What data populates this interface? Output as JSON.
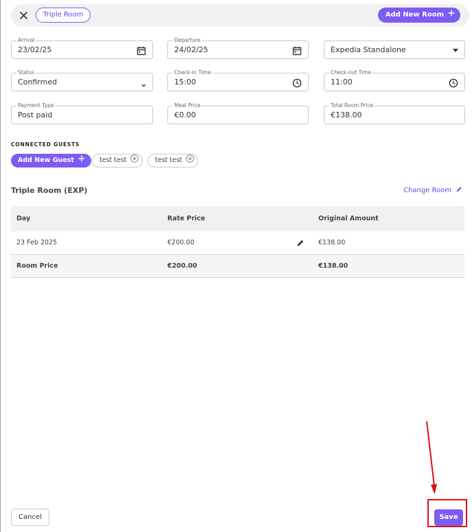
{
  "header": {
    "room_chip": "Triple Room",
    "add_room_label": "Add New Room"
  },
  "fields": {
    "arrival": {
      "label": "Arrival",
      "value": "23/02/25"
    },
    "departure": {
      "label": "Departure",
      "value": "24/02/25"
    },
    "channel": {
      "value": "Expedia Standalone"
    },
    "status": {
      "label": "Status",
      "value": "Confirmed"
    },
    "checkin": {
      "label": "Check-in Time",
      "value": "15:00"
    },
    "checkout": {
      "label": "Check-out Time",
      "value": "11:00"
    },
    "payment": {
      "label": "Payment Type",
      "value": "Post paid"
    },
    "meal_price": {
      "label": "Meal Price",
      "value": "€0.00"
    },
    "total_room_price": {
      "label": "Total Room Price",
      "value": "€138.00"
    }
  },
  "guests": {
    "section_title": "CONNECTED GUESTS",
    "add_label": "Add New Guest",
    "items": [
      {
        "name": "test test"
      },
      {
        "name": "test test"
      }
    ]
  },
  "room": {
    "heading": "Triple Room (EXP)",
    "change_label": "Change Room"
  },
  "table": {
    "headers": [
      "Day",
      "Rate Price",
      "Original Amount"
    ],
    "rows": [
      {
        "day": "23 Feb 2025",
        "rate": "€200.00",
        "original": "€138.00"
      }
    ],
    "total": {
      "label": "Room Price",
      "rate": "€200.00",
      "original": "€138.00"
    }
  },
  "footer": {
    "cancel_label": "Cancel",
    "save_label": "Save"
  },
  "colors": {
    "accent": "#7c5cf2",
    "annotation": "#e01010"
  }
}
